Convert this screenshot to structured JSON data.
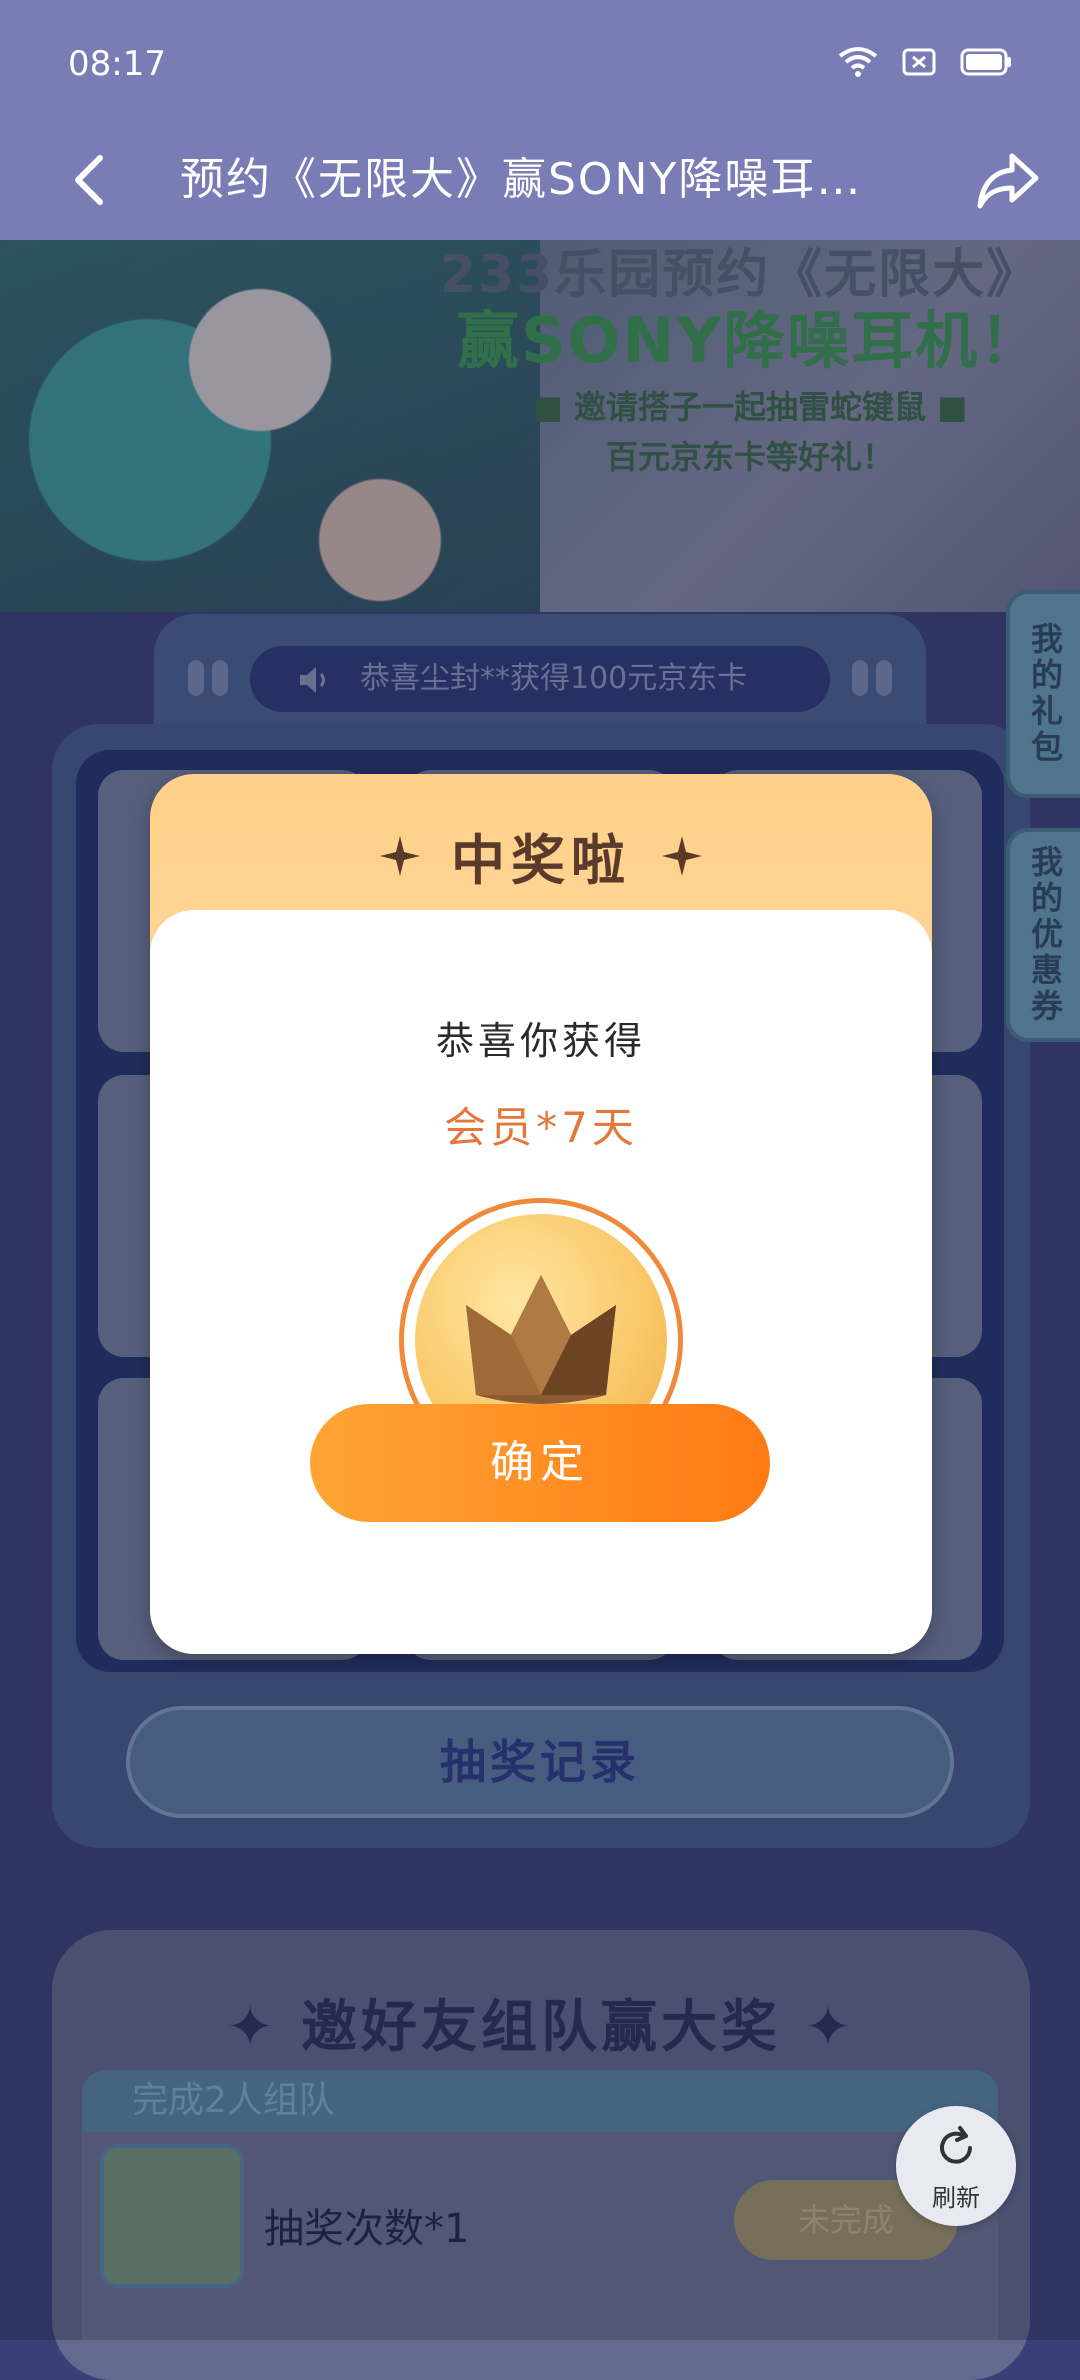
{
  "status_bar": {
    "time": "08:17"
  },
  "header": {
    "title": "预约《无限大》赢SONY降噪耳 …"
  },
  "banner": {
    "line1": "233乐园预约《无限大》",
    "line2": "赢SONY降噪耳机！",
    "line3": "■ 邀请搭子一起抽雷蛇键鼠 ■",
    "line4": "百元京东卡等好礼！"
  },
  "side_tabs": {
    "gift": "我的礼包",
    "coupon": "我的优惠券"
  },
  "lottery": {
    "marquee": "恭喜尘封**获得100元京东卡",
    "record_button": "抽奖记录"
  },
  "prize_modal": {
    "title": "中奖啦",
    "congrats": "恭喜你获得",
    "prize_name": "会员*7天",
    "prize_icon": "crown-icon",
    "confirm_button": "确定"
  },
  "team": {
    "title": "邀好友组队赢大奖",
    "task_label": "完成2人组队",
    "reward": "抽奖次数*1",
    "status": "未完成"
  },
  "refresh": {
    "label": "刷新"
  },
  "colors": {
    "header_bg": "#7a7cb6",
    "accent_orange": "#ff8a1f",
    "prize_text": "#e4783a",
    "board_blue": "#23356e"
  }
}
